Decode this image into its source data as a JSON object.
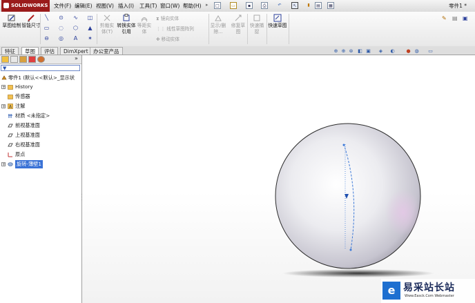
{
  "app": {
    "logo_text": "SOLIDWORKS",
    "document_title": "零件1 *"
  },
  "menu": [
    "文件(F)",
    "编辑(E)",
    "视图(V)",
    "插入(I)",
    "工具(T)",
    "窗口(W)",
    "帮助(H)"
  ],
  "ribbon": {
    "sketch": "草图绘制",
    "smart_dim": "智能尺寸",
    "trim": "剪裁实体(T)",
    "convert": "转换实体引用",
    "offset": "等距实体",
    "mirror": "镜向实体",
    "linear_array": "线性草图阵列",
    "move": "移动实体",
    "display_delete": "显示/删除...",
    "repair": "修复草图",
    "quick_snap": "快速捕捉",
    "rapid_sketch": "快速草图"
  },
  "tabs": [
    "特征",
    "草图",
    "评估",
    "DimXpert",
    "办公室产品"
  ],
  "active_tab": 1,
  "tree": {
    "root": "零件1 (默认<<默认>_显示状",
    "items": [
      {
        "label": "History",
        "expandable": true
      },
      {
        "label": "传感器",
        "expandable": false
      },
      {
        "label": "注解",
        "expandable": true
      },
      {
        "label": "材质 <未指定>",
        "expandable": false
      },
      {
        "label": "前视基准面",
        "expandable": false
      },
      {
        "label": "上视基准面",
        "expandable": false
      },
      {
        "label": "右视基准面",
        "expandable": false
      },
      {
        "label": "原点",
        "expandable": false
      },
      {
        "label": "旋转-薄壁1",
        "expandable": true,
        "selected": true
      }
    ]
  },
  "watermark": {
    "logo": "e",
    "text": "易采站长站",
    "sub": "Www.Easck.Com  Webmaster"
  },
  "colors": {
    "accent": "#3a72d6",
    "logo_red": "#9a1b1b",
    "selection": "#3a72d6"
  }
}
